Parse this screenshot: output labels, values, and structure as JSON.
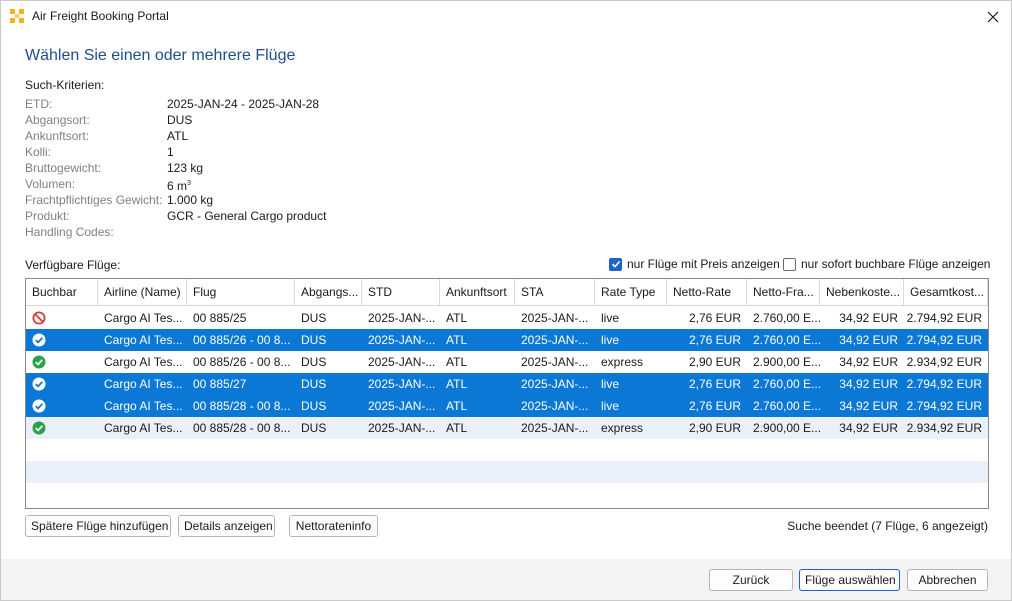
{
  "window": {
    "title": "Air Freight Booking Portal"
  },
  "heading": "Wählen Sie einen oder mehrere Flüge",
  "criteria": {
    "title": "Such-Kriterien:",
    "items": [
      {
        "label": "ETD:",
        "value": "2025-JAN-24 - 2025-JAN-28"
      },
      {
        "label": "Abgangsort:",
        "value": "DUS"
      },
      {
        "label": "Ankunftsort:",
        "value": "ATL"
      },
      {
        "label": "Kolli:",
        "value": "1"
      },
      {
        "label": "Bruttogewicht:",
        "value": "123 kg"
      },
      {
        "label": "Volumen:",
        "value": "6 m",
        "sup": "3"
      },
      {
        "label": "Frachtpflichtiges Gewicht:",
        "value": "1.000 kg"
      },
      {
        "label": "Produkt:",
        "value": "GCR - General Cargo product"
      },
      {
        "label": "Handling Codes:",
        "value": ""
      }
    ]
  },
  "flights": {
    "label": "Verfügbare Flüge:",
    "filter_price": {
      "label": "nur Flüge mit Preis anzeigen",
      "checked": true
    },
    "filter_bookable": {
      "label": "nur sofort buchbare Flüge anzeigen",
      "checked": false
    },
    "columns": [
      "Buchbar",
      "Airline (Name)",
      "Flug",
      "Abgangs...",
      "STD",
      "Ankunftsort",
      "STA",
      "Rate Type",
      "Netto-Rate",
      "Netto-Fra...",
      "Nebenkoste...",
      "Gesamtkost..."
    ],
    "rows": [
      {
        "status": "not-bookable-icon",
        "airline": "Cargo AI Tes...",
        "flight": "00 885/25",
        "origin": "DUS",
        "std": "2025-JAN-...",
        "dest": "ATL",
        "sta": "2025-JAN-...",
        "rate_type": "live",
        "net_rate": "2,76 EUR",
        "net_freight": "2.760,00 E...",
        "surcharges": "34,92 EUR",
        "total": "2.794,92 EUR",
        "selected": false
      },
      {
        "status": "bookable-icon",
        "airline": "Cargo AI Tes...",
        "flight": "00 885/26 - 00 8...",
        "origin": "DUS",
        "std": "2025-JAN-...",
        "dest": "ATL",
        "sta": "2025-JAN-...",
        "rate_type": "live",
        "net_rate": "2,76 EUR",
        "net_freight": "2.760,00 E...",
        "surcharges": "34,92 EUR",
        "total": "2.794,92 EUR",
        "selected": true
      },
      {
        "status": "bookable-icon",
        "airline": "Cargo AI Tes...",
        "flight": "00 885/26 - 00 8...",
        "origin": "DUS",
        "std": "2025-JAN-...",
        "dest": "ATL",
        "sta": "2025-JAN-...",
        "rate_type": "express",
        "net_rate": "2,90 EUR",
        "net_freight": "2.900,00 E...",
        "surcharges": "34,92 EUR",
        "total": "2.934,92 EUR",
        "selected": false
      },
      {
        "status": "bookable-icon",
        "airline": "Cargo AI Tes...",
        "flight": "00 885/27",
        "origin": "DUS",
        "std": "2025-JAN-...",
        "dest": "ATL",
        "sta": "2025-JAN-...",
        "rate_type": "live",
        "net_rate": "2,76 EUR",
        "net_freight": "2.760,00 E...",
        "surcharges": "34,92 EUR",
        "total": "2.794,92 EUR",
        "selected": true
      },
      {
        "status": "bookable-icon",
        "airline": "Cargo AI Tes...",
        "flight": "00 885/28 - 00 8...",
        "origin": "DUS",
        "std": "2025-JAN-...",
        "dest": "ATL",
        "sta": "2025-JAN-...",
        "rate_type": "live",
        "net_rate": "2,76 EUR",
        "net_freight": "2.760,00 E...",
        "surcharges": "34,92 EUR",
        "total": "2.794,92 EUR",
        "selected": true
      },
      {
        "status": "bookable-icon",
        "airline": "Cargo AI Tes...",
        "flight": "00 885/28 - 00 8...",
        "origin": "DUS",
        "std": "2025-JAN-...",
        "dest": "ATL",
        "sta": "2025-JAN-...",
        "rate_type": "express",
        "net_rate": "2,90 EUR",
        "net_freight": "2.900,00 E...",
        "surcharges": "34,92 EUR",
        "total": "2.934,92 EUR",
        "selected": false
      }
    ]
  },
  "actions": {
    "later_flights": "Spätere Flüge hinzufügen",
    "details": "Details anzeigen",
    "net_rate_info": "Nettorateninfo",
    "status": "Suche beendet (7 Flüge, 6 angezeigt)"
  },
  "footer": {
    "back": "Zurück",
    "select": "Flüge auswählen",
    "cancel": "Abbrechen"
  },
  "colors": {
    "selection": "#0a78d4",
    "heading": "#1f4e8c",
    "bookable": "#2aa24a",
    "not_bookable": "#d83b3b",
    "app_icon": "#f2b418"
  }
}
